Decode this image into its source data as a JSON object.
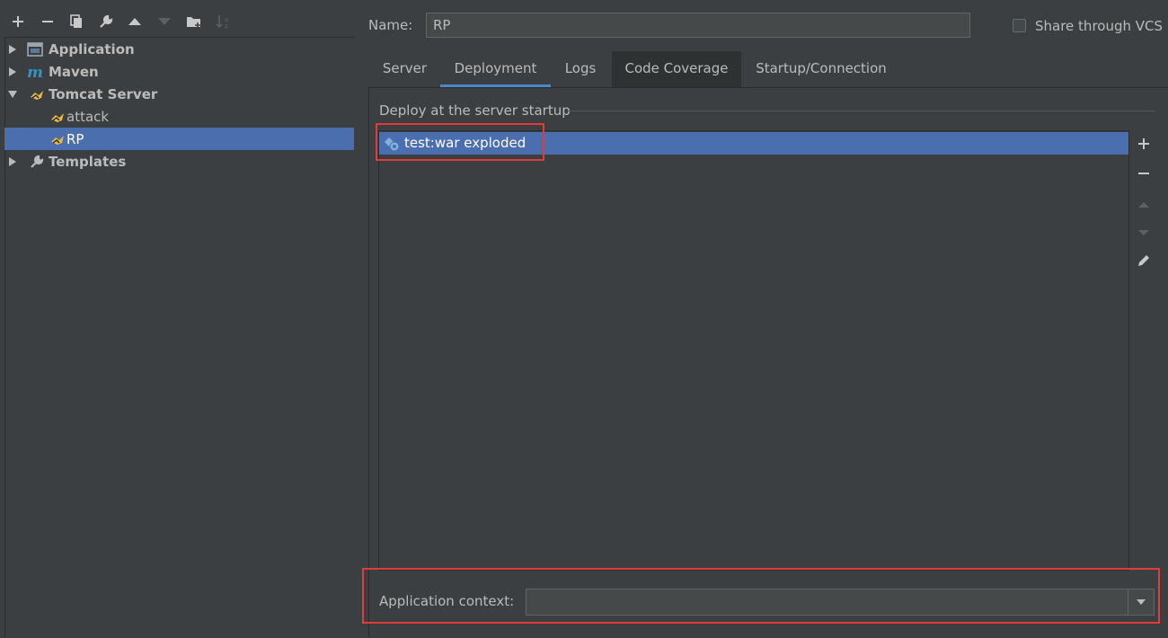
{
  "toolbar": {
    "icons": [
      "add-icon",
      "remove-icon",
      "copy-icon",
      "wrench-icon",
      "move-up-icon",
      "move-down-icon",
      "new-folder-icon",
      "sort-icon"
    ]
  },
  "tree": {
    "items": [
      {
        "label": "Application",
        "icon": "application-icon",
        "expanded": false,
        "level": 0
      },
      {
        "label": "Maven",
        "icon": "maven-icon",
        "expanded": false,
        "level": 0
      },
      {
        "label": "Tomcat Server",
        "icon": "tomcat-icon",
        "expanded": true,
        "level": 0
      },
      {
        "label": "attack",
        "icon": "tomcat-icon",
        "level": 1
      },
      {
        "label": "RP",
        "icon": "tomcat-icon",
        "level": 1,
        "selected": true
      },
      {
        "label": "Templates",
        "icon": "wrench-icon",
        "expanded": false,
        "level": 0
      }
    ]
  },
  "config": {
    "name_label": "Name:",
    "name_value": "RP",
    "share_vcs_label": "Share through VCS",
    "share_vcs_checked": false
  },
  "tabs": [
    {
      "label": "Server"
    },
    {
      "label": "Deployment",
      "active": true
    },
    {
      "label": "Logs"
    },
    {
      "label": "Code Coverage"
    },
    {
      "label": "Startup/Connection"
    }
  ],
  "deployment": {
    "section_title": "Deploy at the server startup",
    "artifacts": [
      {
        "label": "test:war exploded",
        "icon": "artifact-icon",
        "selected": true
      }
    ],
    "side_buttons": [
      "add-icon",
      "remove-icon",
      "move-up-icon",
      "move-down-icon",
      "edit-icon"
    ],
    "context_label": "Application context:",
    "context_value": ""
  },
  "colors": {
    "background": "#3c3f41",
    "selection": "#4b6eaf",
    "text": "#bbbbbb",
    "tab_underline": "#4a88c7",
    "highlight_box": "#e03c3c"
  }
}
